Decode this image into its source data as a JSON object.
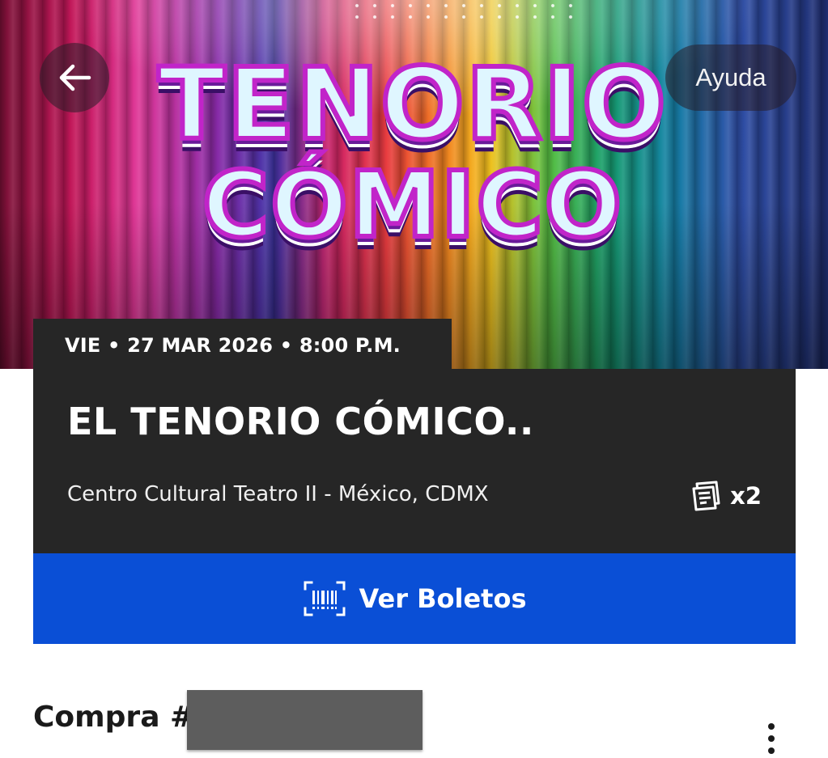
{
  "hero": {
    "logo_line1": "TENORIO",
    "logo_line2": "CÓMICO",
    "back_icon": "arrow-left-icon",
    "help_label": "Ayuda"
  },
  "event": {
    "date_line": "VIE • 27 MAR 2026 • 8:00 P.M.",
    "title": "EL TENORIO CÓMICO..",
    "venue": "Centro Cultural Teatro II - México, CDMX",
    "ticket_icon": "tickets-icon",
    "ticket_count": "x2",
    "view_tickets_icon": "barcode-scan-icon",
    "view_tickets_label": "Ver Boletos"
  },
  "purchase": {
    "title": "Compra #",
    "more_icon": "more-vertical-icon"
  },
  "colors": {
    "card_bg": "#262626",
    "accent_button": "#0a4fd6",
    "text_dark": "#1a1a1a",
    "logo_outline": "#c124c9"
  }
}
